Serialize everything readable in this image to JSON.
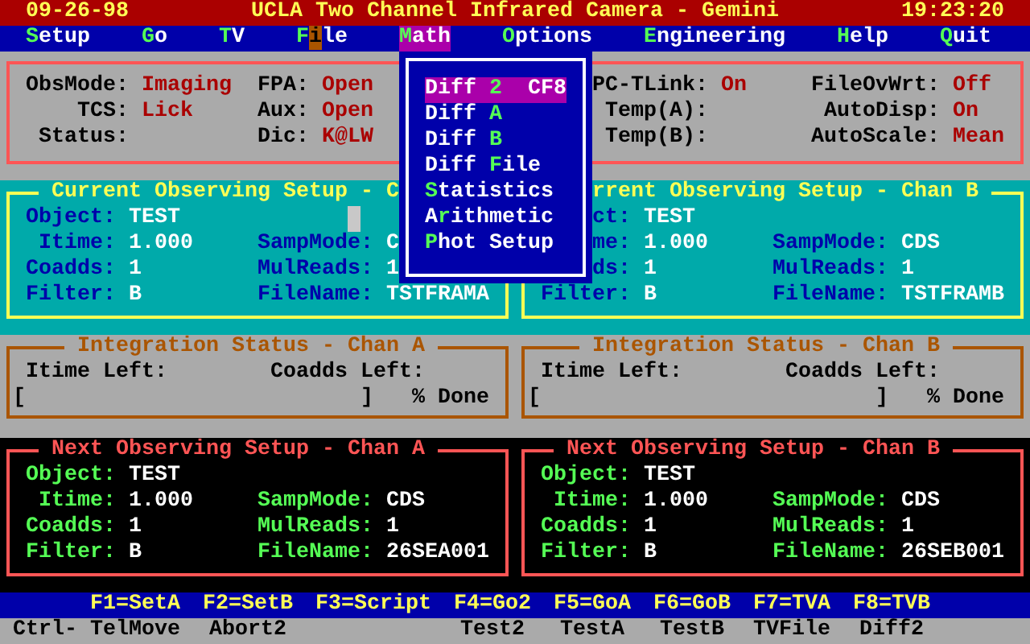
{
  "title_bar": {
    "date": "09-26-98",
    "title": "UCLA Two Channel Infrared Camera - Gemini",
    "time": "19:23:20"
  },
  "menu_bar": [
    {
      "selected": false,
      "parts": [
        {
          "kind": "hotkey",
          "text": "S"
        },
        {
          "kind": "plain",
          "text": "etup"
        }
      ]
    },
    {
      "selected": false,
      "parts": [
        {
          "kind": "hotkey",
          "text": "G"
        },
        {
          "kind": "plain",
          "text": "o"
        }
      ]
    },
    {
      "selected": false,
      "parts": [
        {
          "kind": "hotkey",
          "text": "T"
        },
        {
          "kind": "plain",
          "text": "V"
        }
      ]
    },
    {
      "selected": false,
      "parts": [
        {
          "kind": "hotkey",
          "text": "F"
        },
        {
          "kind": "cursor",
          "text": "i"
        },
        {
          "kind": "plain",
          "text": "le"
        }
      ]
    },
    {
      "selected": true,
      "parts": [
        {
          "kind": "hotkey",
          "text": "M"
        },
        {
          "kind": "plain",
          "text": "ath"
        }
      ]
    },
    {
      "selected": false,
      "parts": [
        {
          "kind": "hotkey",
          "text": "O"
        },
        {
          "kind": "plain",
          "text": "ptions"
        }
      ]
    },
    {
      "selected": false,
      "parts": [
        {
          "kind": "hotkey",
          "text": "E"
        },
        {
          "kind": "plain",
          "text": "ngineering"
        }
      ]
    },
    {
      "selected": false,
      "parts": [
        {
          "kind": "hotkey",
          "text": "H"
        },
        {
          "kind": "plain",
          "text": "elp"
        }
      ]
    },
    {
      "selected": false,
      "parts": [
        {
          "kind": "hotkey",
          "text": "Q"
        },
        {
          "kind": "plain",
          "text": "uit"
        }
      ]
    }
  ],
  "math_menu": [
    {
      "selected": true,
      "shortcut": "CF8",
      "parts": [
        {
          "kind": "plain",
          "text": "Diff "
        },
        {
          "kind": "hotkey",
          "text": "2"
        }
      ]
    },
    {
      "selected": false,
      "parts": [
        {
          "kind": "plain",
          "text": "Diff "
        },
        {
          "kind": "hotkey",
          "text": "A"
        }
      ]
    },
    {
      "selected": false,
      "parts": [
        {
          "kind": "plain",
          "text": "Diff "
        },
        {
          "kind": "hotkey",
          "text": "B"
        }
      ]
    },
    {
      "selected": false,
      "parts": [
        {
          "kind": "plain",
          "text": "Diff "
        },
        {
          "kind": "hotkey",
          "text": "F"
        },
        {
          "kind": "plain",
          "text": "ile"
        }
      ]
    },
    {
      "selected": false,
      "parts": [
        {
          "kind": "hotkey",
          "text": "S"
        },
        {
          "kind": "plain",
          "text": "tatistics"
        }
      ]
    },
    {
      "selected": false,
      "parts": [
        {
          "kind": "plain",
          "text": "A"
        },
        {
          "kind": "hotkey",
          "text": "r"
        },
        {
          "kind": "plain",
          "text": "ithmetic"
        }
      ]
    },
    {
      "selected": false,
      "parts": [
        {
          "kind": "hotkey",
          "text": "P"
        },
        {
          "kind": "plain",
          "text": "hot Setup"
        }
      ]
    }
  ],
  "status_panel": [
    [
      {
        "label": "ObsMode:",
        "value": "Imaging"
      },
      {
        "label": "FPA:",
        "value": "Open"
      },
      {
        "label": "PC-TLink:",
        "value": "On"
      },
      {
        "label": "FileOvWrt:",
        "value": "Off"
      }
    ],
    [
      {
        "label": "TCS:",
        "value": "Lick"
      },
      {
        "label": "Aux:",
        "value": "Open"
      },
      {
        "label": "Temp(A):"
      },
      {
        "label": "AutoDisp:",
        "value": "On"
      }
    ],
    [
      {
        "label": "Status:"
      },
      {
        "label": "Dic:",
        "value": "K@LW"
      },
      {
        "label": "Temp(B):"
      },
      {
        "label": "AutoScale:",
        "value": "Mean"
      }
    ]
  ],
  "current_setup": [
    {
      "title": "Current Observing Setup - C",
      "input_cursor": true,
      "rows": [
        [
          {
            "label": "Object:",
            "value": "TEST"
          }
        ],
        [
          {
            "label": "Itime:",
            "value": "1.000"
          },
          {
            "label": "SampMode:",
            "value": "C"
          }
        ],
        [
          {
            "label": "Coadds:",
            "value": "1"
          },
          {
            "label": "MulReads:",
            "value": "1"
          }
        ],
        [
          {
            "label": "Filter:",
            "value": "B"
          },
          {
            "label": "FileName:",
            "value": "TSTFRAMA"
          }
        ]
      ]
    },
    {
      "title": "rrent Observing Setup - Chan B",
      "input_cursor": false,
      "rows": [
        [
          {
            "label": "ct:",
            "value": "TEST"
          }
        ],
        [
          {
            "label": "me:",
            "value": "1.000"
          },
          {
            "label": "SampMode:",
            "value": "CDS"
          }
        ],
        [
          {
            "label": "ds:",
            "value": "1"
          },
          {
            "label": "MulReads:",
            "value": "1"
          }
        ],
        [
          {
            "label": "Filter:",
            "value": "B"
          },
          {
            "label": "FileName:",
            "value": "TSTFRAMB"
          }
        ]
      ]
    }
  ],
  "integration_status": [
    {
      "title": "Integration Status - Chan A",
      "itime_label": "Itime Left:",
      "coadds_label": "Coadds Left:",
      "open": "[",
      "close": "]",
      "suffix": "% Done"
    },
    {
      "title": "Integration Status - Chan B",
      "itime_label": "Itime Left:",
      "coadds_label": "Coadds Left:",
      "open": "[",
      "close": "]",
      "suffix": "% Done"
    }
  ],
  "next_setup": [
    {
      "title": "Next Observing Setup - Chan A",
      "rows": [
        [
          {
            "label": "Object:",
            "value": "TEST"
          }
        ],
        [
          {
            "label": "Itime:",
            "value": "1.000"
          },
          {
            "label": "SampMode:",
            "value": "CDS"
          }
        ],
        [
          {
            "label": "Coadds:",
            "value": "1"
          },
          {
            "label": "MulReads:",
            "value": "1"
          }
        ],
        [
          {
            "label": "Filter:",
            "value": "B"
          },
          {
            "label": "FileName:",
            "value": "26SEA001"
          }
        ]
      ]
    },
    {
      "title": "Next Observing Setup - Chan B",
      "rows": [
        [
          {
            "label": "Object:",
            "value": "TEST"
          }
        ],
        [
          {
            "label": "Itime:",
            "value": "1.000"
          },
          {
            "label": "SampMode:",
            "value": "CDS"
          }
        ],
        [
          {
            "label": "Coadds:",
            "value": "1"
          },
          {
            "label": "MulReads:",
            "value": "1"
          }
        ],
        [
          {
            "label": "Filter:",
            "value": "B"
          },
          {
            "label": "FileName:",
            "value": "26SEB001"
          }
        ]
      ]
    }
  ],
  "function_keys": {
    "ctrl_label": "Ctrl-",
    "keys": [
      {
        "key": "F1=SetA",
        "ctrl": "TelMove"
      },
      {
        "key": "F2=SetB",
        "ctrl": "Abort2"
      },
      {
        "key": "F3=Script"
      },
      {
        "key": "F4=Go2",
        "ctrl": "Test2"
      },
      {
        "key": "F5=GoA",
        "ctrl": "TestA"
      },
      {
        "key": "F6=GoB",
        "ctrl": "TestB"
      },
      {
        "key": "F7=TVA",
        "ctrl": "TVFile"
      },
      {
        "key": "F8=TVB",
        "ctrl": "Diff2"
      }
    ]
  }
}
